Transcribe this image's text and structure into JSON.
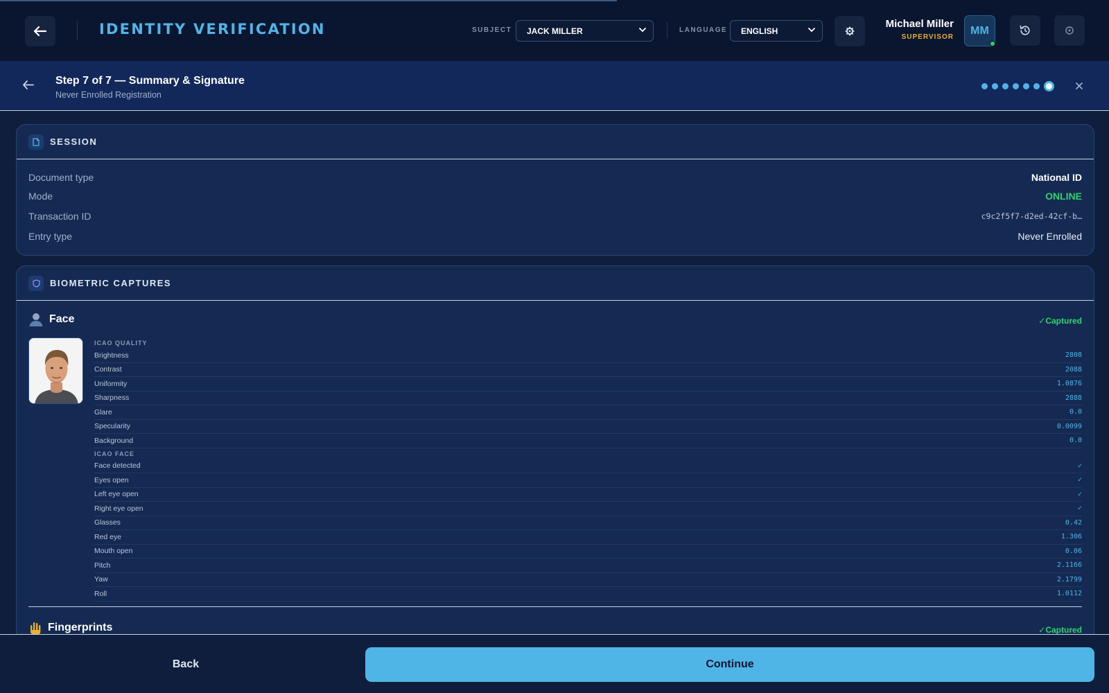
{
  "header": {
    "title": "IDENTITY VERIFICATION",
    "subject_label": "SUBJECT",
    "subject_value": "JACK MILLER",
    "language_label": "LANGUAGE",
    "language_value": "ENGLISH",
    "user_name": "Michael Miller",
    "user_role": "SUPERVISOR",
    "avatar_initials": "MM",
    "icons": [
      "arrow-left-icon",
      "gear-icon",
      "history-icon",
      "power-icon"
    ]
  },
  "step": {
    "title": "Step 7 of 7 — Summary & Signature",
    "subtitle": "Never Enrolled Registration",
    "current": 7,
    "total": 7
  },
  "session": {
    "title": "SESSION",
    "rows": [
      {
        "key": "Document type",
        "value": "National ID"
      },
      {
        "key": "Mode",
        "value": "ONLINE"
      },
      {
        "key": "Transaction ID",
        "value": "c9c2f5f7-d2ed-42cf-b…"
      },
      {
        "key": "Entry type",
        "value": "Never Enrolled"
      }
    ]
  },
  "biometrics": {
    "title": "BIOMETRIC CAPTURES",
    "face": {
      "label": "Face",
      "status": "✓Captured",
      "icao_quality_label": "ICAO QUALITY",
      "icao_quality": [
        {
          "key": "Brightness",
          "value": "2808"
        },
        {
          "key": "Contrast",
          "value": "2088"
        },
        {
          "key": "Uniformity",
          "value": "1.0876"
        },
        {
          "key": "Sharpness",
          "value": "2888"
        },
        {
          "key": "Glare",
          "value": "0.0"
        },
        {
          "key": "Specularity",
          "value": "0.0099"
        },
        {
          "key": "Background",
          "value": "0.0"
        }
      ],
      "icao_face_label": "ICAO FACE",
      "icao_face": [
        {
          "key": "Face detected",
          "value": "✓"
        },
        {
          "key": "Eyes open",
          "value": "✓"
        },
        {
          "key": "Left eye open",
          "value": "✓"
        },
        {
          "key": "Right eye open",
          "value": "✓"
        },
        {
          "key": "Glasses",
          "value": "0.42"
        },
        {
          "key": "Red eye",
          "value": "1.306"
        },
        {
          "key": "Mouth open",
          "value": "0.06"
        },
        {
          "key": "Pitch",
          "value": "2.1166"
        },
        {
          "key": "Yaw",
          "value": "2.1799"
        },
        {
          "key": "Roll",
          "value": "1.0112"
        }
      ]
    },
    "fingerprints": {
      "label": "Fingerprints",
      "status": "✓Captured"
    }
  },
  "footer": {
    "back_label": "Back",
    "continue_label": "Continue"
  },
  "colors": {
    "accent": "#4fb5e6",
    "success": "#2dd36f",
    "role": "#e8b22c",
    "background": "#0f1e3d"
  }
}
